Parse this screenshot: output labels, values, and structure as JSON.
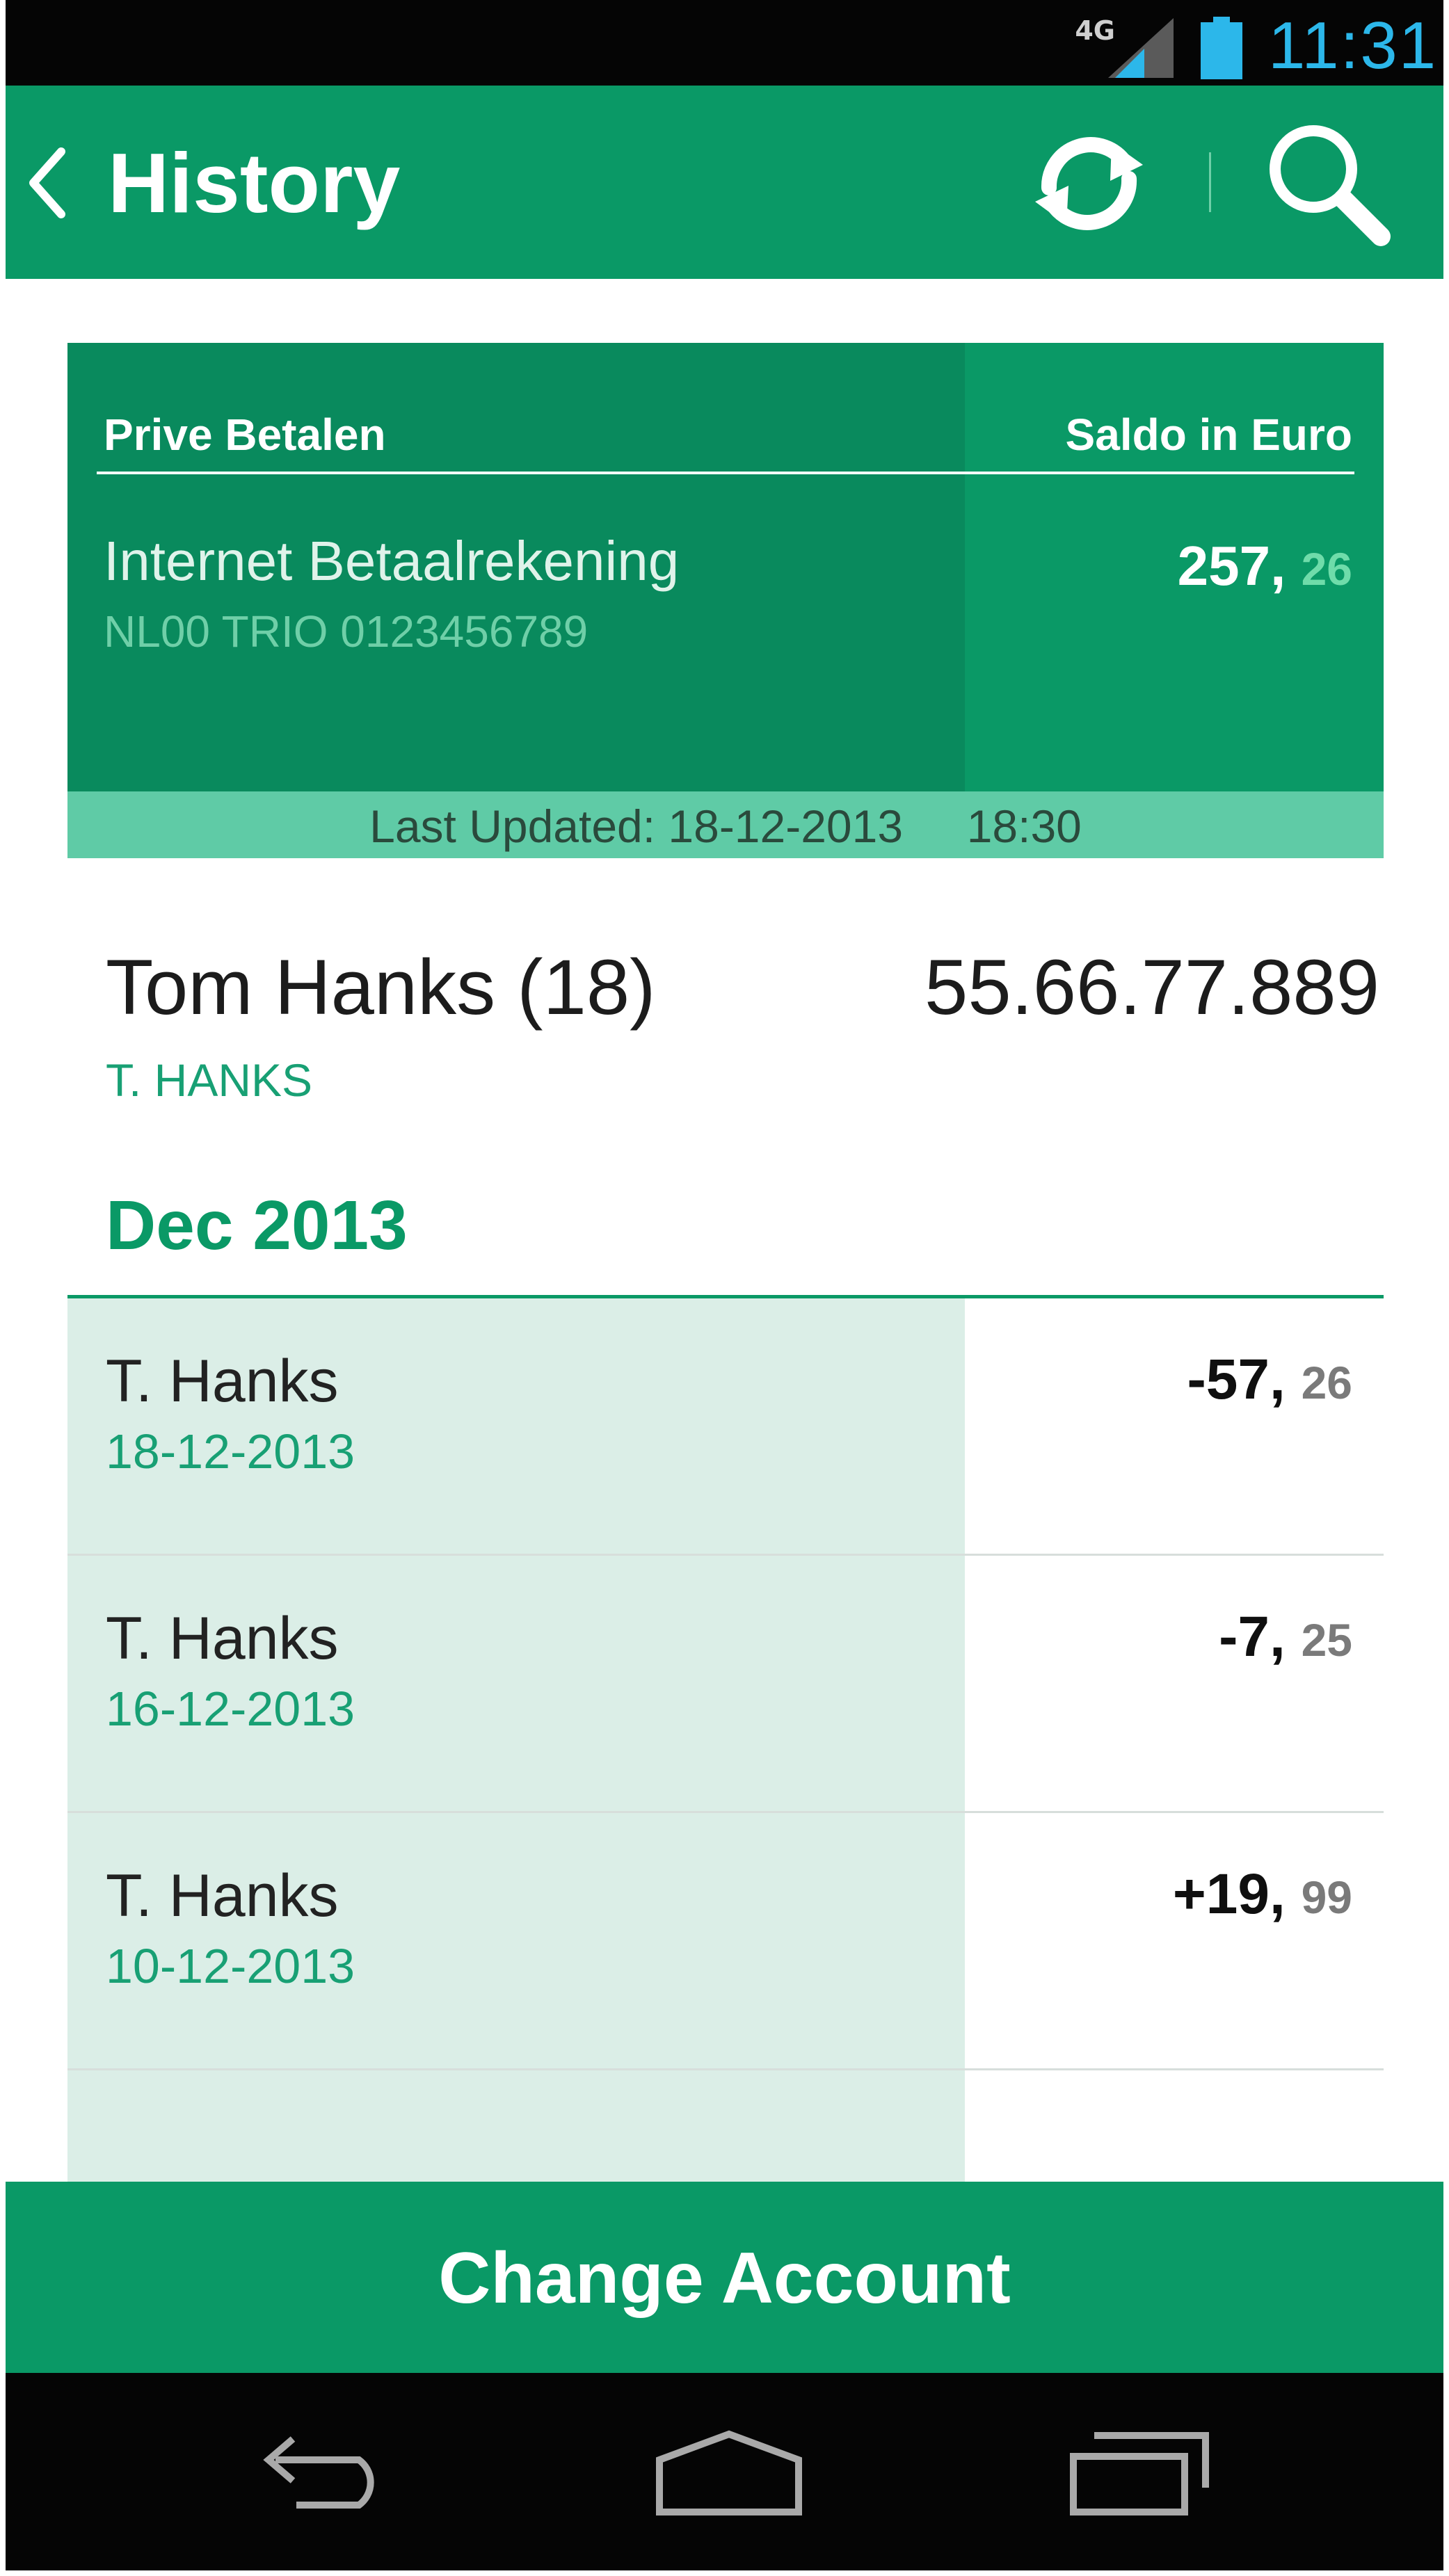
{
  "status_bar": {
    "network": "4G",
    "time": "11:31",
    "icons": [
      "signal-icon",
      "battery-icon"
    ],
    "time_color": "#2cb7ea"
  },
  "app_bar": {
    "title": "History",
    "icons": [
      "back-icon",
      "refresh-icon",
      "search-icon"
    ],
    "color": "#0a9966"
  },
  "account_card": {
    "section_label": "Prive Betalen",
    "balance_label": "Saldo in Euro",
    "account_name": "Internet Betaalrekening",
    "iban": "NL00 TRIO 0123456789",
    "balance_int": "257,",
    "balance_dec": "26",
    "last_updated": "Last Updated: 18-12-2013     18:30"
  },
  "owner": {
    "name": "Tom Hanks (18)",
    "number": "55.66.77.889",
    "short_name": "T. HANKS"
  },
  "month_header": "Dec 2013",
  "transactions": [
    {
      "name": "T. Hanks",
      "date": "18-12-2013",
      "amount_int": "-57,",
      "amount_dec": "26"
    },
    {
      "name": "T. Hanks",
      "date": "16-12-2013",
      "amount_int": "-7,",
      "amount_dec": "25"
    },
    {
      "name": "T. Hanks",
      "date": "10-12-2013",
      "amount_int": "+19,",
      "amount_dec": "99"
    }
  ],
  "change_account_label": "Change Account",
  "nav_bar": {
    "icons": [
      "nav-back-icon",
      "nav-home-icon",
      "nav-recent-apps-icon"
    ]
  }
}
